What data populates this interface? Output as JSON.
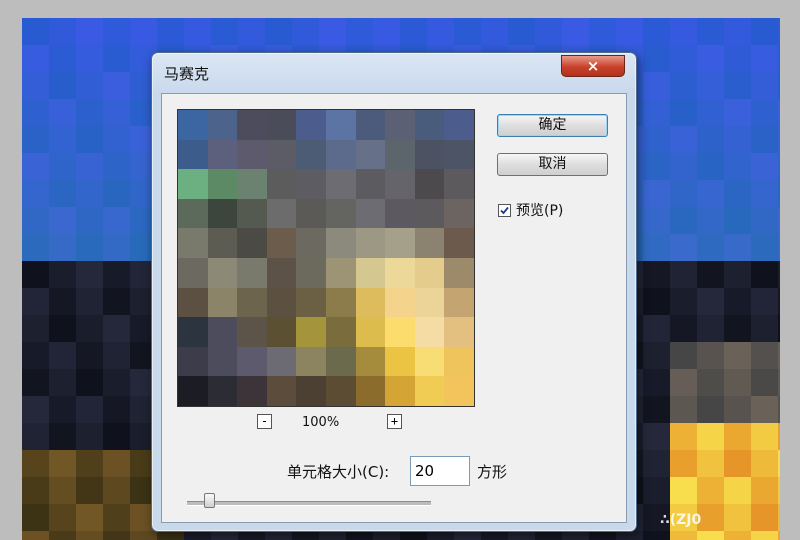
{
  "dialog": {
    "title": "马赛克",
    "close_glyph": "×",
    "zoom_level": "100%",
    "zoom_out_label": "-",
    "zoom_in_label": "+",
    "ok_label": "确定",
    "cancel_label": "取消",
    "preview_label": "预览(P)",
    "preview_checked": true,
    "cell_size_label": "单元格大小(C):",
    "cell_size_value": "20",
    "cell_size_unit": "方形",
    "slider_fraction": 0.09
  },
  "colors": {
    "preview_grid": [
      [
        "#3c66a2",
        "#4c648c",
        "#4c4c5c",
        "#4a4c5a",
        "#4c5c8c",
        "#5c74a4",
        "#4c5a7c",
        "#5c6074",
        "#4a5c7c",
        "#4c5c8c"
      ],
      [
        "#3c5c8c",
        "#5c607c",
        "#5c5a6c",
        "#5c5c66",
        "#4c5c74",
        "#5c6a8c",
        "#667088",
        "#5c646c",
        "#4c5262",
        "#4c5466"
      ],
      [
        "#6cb082",
        "#5c8a64",
        "#6c8270",
        "#5c5c5c",
        "#5c5c62",
        "#6c6c72",
        "#5c5c60",
        "#64646a",
        "#4c4a4c",
        "#5c5a5c"
      ],
      [
        "#5c6a5c",
        "#3c463c",
        "#545a50",
        "#6c6c6c",
        "#5c5a56",
        "#646460",
        "#6c6c72",
        "#5c5a60",
        "#5c5a5c",
        "#6c6460"
      ],
      [
        "#7a7a6c",
        "#5c5c52",
        "#4c4a44",
        "#6c5c4c",
        "#6c6a60",
        "#8c8a7c",
        "#9c9884",
        "#a4a08a",
        "#8c8270",
        "#6c5a4c"
      ],
      [
        "#6c6a60",
        "#8c8a76",
        "#7a7a6c",
        "#5c5248",
        "#6c6a5c",
        "#9c9474",
        "#d4c890",
        "#ecd898",
        "#e4cc8c",
        "#9c8a6a"
      ],
      [
        "#5c5042",
        "#8c8468",
        "#6c644c",
        "#5c5040",
        "#6c6044",
        "#8c7c4c",
        "#dcbc5c",
        "#f4d48c",
        "#ecd498",
        "#c4a470"
      ],
      [
        "#2c3440",
        "#4c4c5c",
        "#5c5448",
        "#5c5032",
        "#a4943c",
        "#7a6c3c",
        "#dcbc4c",
        "#fcdc6c",
        "#f4dca4",
        "#e4c080"
      ],
      [
        "#3c3c4a",
        "#4c4c5c",
        "#5c5a6c",
        "#6c6a72",
        "#8c8460",
        "#6c6a4c",
        "#a48c3c",
        "#ecc444",
        "#f8dc74",
        "#f0c45c"
      ],
      [
        "#1c1c24",
        "#2c2c34",
        "#3c3438",
        "#5c4c3c",
        "#4c4032",
        "#5c4c34",
        "#8c6c2c",
        "#d4a434",
        "#f0cc54",
        "#f4c45c"
      ]
    ],
    "accent": "#3c7fb1"
  },
  "watermark": "∴(ZJ0"
}
